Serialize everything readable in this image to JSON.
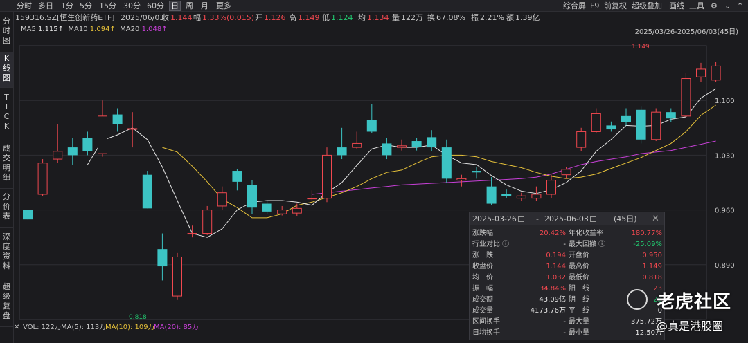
{
  "toolbar": {
    "periods": [
      "分时",
      "多日",
      "1分",
      "5分",
      "15分",
      "30分",
      "60分",
      "日",
      "周",
      "月",
      "更多"
    ],
    "active_period": "日",
    "right": [
      "综合屏",
      "F9",
      "前复权",
      "超级叠加",
      "画线",
      "工具"
    ]
  },
  "info": {
    "code": "159316.SZ[恒生创新药ETF]",
    "date": "2025/06/03",
    "close_label": "收",
    "close": "1.144",
    "change_label": "幅",
    "change": "1.33%(0.015)",
    "open_label": "开",
    "open": "1.126",
    "high_label": "高",
    "high": "1.149",
    "low_label": "低",
    "low": "1.124",
    "avg_label": "均",
    "avg": "1.134",
    "volume_label": "量",
    "volume": "122万",
    "turnover_label": "换",
    "turnover": "67.08%",
    "amplitude_label": "振",
    "amplitude": "2.21%",
    "amount_label": "额",
    "amount": "1.39亿"
  },
  "left_tabs": [
    "分\n时\n图",
    "K\n线\n图",
    "T\nI\nC\nK",
    "成\n交\n明\n细",
    "分\n价\n表",
    "深\n度\n资\n料",
    "超\n级\n复\n盘"
  ],
  "active_tab": "K\n线\n图",
  "ma": {
    "ma5_label": "MA5",
    "ma5": "1.115↑",
    "ma10_label": "MA10",
    "ma10": "1.094↑",
    "ma20_label": "MA20",
    "ma20": "1.048↑"
  },
  "date_range": "2025/03/26-2025/06/03(45日)",
  "y_labels": [
    "1.100",
    "1.030",
    "0.960",
    "0.890"
  ],
  "price_high_label": "1.149",
  "price_low_label": "0.818",
  "volbar": {
    "vol": "VOL: 122万",
    "ma5": "MA(5): 113万",
    "ma10": "MA(10): 109万",
    "ma20": "MA(20): 85万",
    "zero": "0"
  },
  "popup": {
    "start": "2025-03-26",
    "end": "2025-06-03",
    "days": "(45日)",
    "dash": "-",
    "rows": [
      {
        "l1": "涨跌幅",
        "v1": "20.42%",
        "c1": "red",
        "l2": "年化收益率",
        "v2": "180.77%",
        "c2": "red"
      },
      {
        "l1": "行业对比 ⓘ",
        "v1": "-",
        "c1": "white",
        "l2": "最大回撤 ⓘ",
        "v2": "-25.09%",
        "c2": "green"
      },
      {
        "l1": "涨　跌",
        "v1": "0.194",
        "c1": "red",
        "l2": "开盘价",
        "v2": "0.950",
        "c2": "red"
      },
      {
        "l1": "收盘价",
        "v1": "1.144",
        "c1": "red",
        "l2": "最高价",
        "v2": "1.149",
        "c2": "red"
      },
      {
        "l1": "均　价",
        "v1": "1.032",
        "c1": "red",
        "l2": "最低价",
        "v2": "0.818",
        "c2": "red"
      },
      {
        "l1": "振　幅",
        "v1": "34.84%",
        "c1": "red",
        "l2": "阳　线",
        "v2": "23",
        "c2": "red"
      },
      {
        "l1": "成交额",
        "v1": "43.09亿",
        "c1": "white",
        "l2": "阴　线",
        "v2": "22",
        "c2": "green"
      },
      {
        "l1": "成交量",
        "v1": "4173.76万",
        "c1": "white",
        "l2": "平　线",
        "v2": "0",
        "c2": "white"
      },
      {
        "l1": "区间换手",
        "v1": "-",
        "c1": "white",
        "l2": "最大量",
        "v2": "375.72万",
        "c2": "white"
      },
      {
        "l1": "日均换手",
        "v1": "-",
        "c1": "white",
        "l2": "最小量",
        "v2": "12.50万",
        "c2": "white"
      }
    ]
  },
  "watermark": {
    "text1": "老虎社区",
    "text2": "@真是港股圈"
  },
  "colors": {
    "up": "#f0484f",
    "down": "#3cc4c4",
    "ma5": "#e6e6e6",
    "ma10": "#e8c33a",
    "ma20": "#c840d8"
  },
  "chart_data": {
    "type": "candlestick",
    "ylim": [
      0.82,
      1.17
    ],
    "candles": [
      {
        "o": 0.96,
        "c": 0.948,
        "h": 0.96,
        "l": 0.948
      },
      {
        "o": 0.98,
        "c": 1.02,
        "h": 1.025,
        "l": 0.978
      },
      {
        "o": 1.025,
        "c": 1.035,
        "h": 1.07,
        "l": 1.02
      },
      {
        "o": 1.04,
        "c": 1.03,
        "h": 1.052,
        "l": 1.018
      },
      {
        "o": 1.052,
        "c": 1.035,
        "h": 1.06,
        "l": 1.03
      },
      {
        "o": 1.032,
        "c": 1.08,
        "h": 1.1,
        "l": 1.028
      },
      {
        "o": 1.082,
        "c": 1.07,
        "h": 1.09,
        "l": 1.06
      },
      {
        "o": 1.064,
        "c": 1.064,
        "h": 1.085,
        "l": 1.04
      },
      {
        "o": 1.005,
        "c": 0.962,
        "h": 1.01,
        "l": 0.962
      },
      {
        "o": 0.91,
        "c": 0.888,
        "h": 0.93,
        "l": 0.87
      },
      {
        "o": 0.85,
        "c": 0.9,
        "h": 0.905,
        "l": 0.845
      },
      {
        "o": 0.93,
        "c": 0.93,
        "h": 0.94,
        "l": 0.925
      },
      {
        "o": 0.93,
        "c": 0.96,
        "h": 0.965,
        "l": 0.928
      },
      {
        "o": 0.965,
        "c": 0.982,
        "h": 0.99,
        "l": 0.96
      },
      {
        "o": 1.01,
        "c": 0.996,
        "h": 1.012,
        "l": 0.985
      },
      {
        "o": 0.992,
        "c": 0.963,
        "h": 0.998,
        "l": 0.955
      },
      {
        "o": 0.968,
        "c": 0.958,
        "h": 0.972,
        "l": 0.955
      },
      {
        "o": 0.955,
        "c": 0.96,
        "h": 0.965,
        "l": 0.953
      },
      {
        "o": 0.956,
        "c": 0.962,
        "h": 0.968,
        "l": 0.952
      },
      {
        "o": 0.975,
        "c": 0.975,
        "h": 0.985,
        "l": 0.97
      },
      {
        "o": 0.975,
        "c": 1.03,
        "h": 1.04,
        "l": 0.97
      },
      {
        "o": 1.04,
        "c": 1.03,
        "h": 1.065,
        "l": 1.025
      },
      {
        "o": 1.04,
        "c": 1.045,
        "h": 1.06,
        "l": 1.038
      },
      {
        "o": 1.075,
        "c": 1.06,
        "h": 1.095,
        "l": 1.058
      },
      {
        "o": 1.045,
        "c": 1.03,
        "h": 1.052,
        "l": 1.025
      },
      {
        "o": 1.04,
        "c": 1.042,
        "h": 1.05,
        "l": 1.036
      },
      {
        "o": 1.048,
        "c": 1.04,
        "h": 1.052,
        "l": 1.036
      },
      {
        "o": 1.053,
        "c": 1.04,
        "h": 1.062,
        "l": 1.035
      },
      {
        "o": 1.04,
        "c": 1.0,
        "h": 1.05,
        "l": 0.995
      },
      {
        "o": 0.998,
        "c": 1.0,
        "h": 1.005,
        "l": 0.99
      },
      {
        "o": 1.01,
        "c": 1.008,
        "h": 1.015,
        "l": 1.0
      },
      {
        "o": 0.99,
        "c": 0.968,
        "h": 1.002,
        "l": 0.966
      },
      {
        "o": 0.98,
        "c": 0.978,
        "h": 0.986,
        "l": 0.975
      },
      {
        "o": 0.975,
        "c": 0.978,
        "h": 0.982,
        "l": 0.972
      },
      {
        "o": 0.975,
        "c": 0.98,
        "h": 0.99,
        "l": 0.972
      },
      {
        "o": 0.98,
        "c": 0.998,
        "h": 1.005,
        "l": 0.975
      },
      {
        "o": 1.005,
        "c": 1.012,
        "h": 1.015,
        "l": 1.0
      },
      {
        "o": 1.04,
        "c": 1.06,
        "h": 1.065,
        "l": 1.035
      },
      {
        "o": 1.06,
        "c": 1.083,
        "h": 1.09,
        "l": 1.058
      },
      {
        "o": 1.068,
        "c": 1.063,
        "h": 1.073,
        "l": 1.06
      },
      {
        "o": 1.08,
        "c": 1.072,
        "h": 1.09,
        "l": 1.068
      },
      {
        "o": 1.088,
        "c": 1.05,
        "h": 1.092,
        "l": 1.045
      },
      {
        "o": 1.05,
        "c": 1.085,
        "h": 1.09,
        "l": 1.048
      },
      {
        "o": 1.085,
        "c": 1.077,
        "h": 1.09,
        "l": 1.072
      },
      {
        "o": 1.08,
        "c": 1.128,
        "h": 1.135,
        "l": 1.078
      },
      {
        "o": 1.13,
        "c": 1.14,
        "h": 1.148,
        "l": 1.124
      },
      {
        "o": 1.126,
        "c": 1.144,
        "h": 1.149,
        "l": 1.124
      }
    ],
    "ma5": [
      null,
      null,
      null,
      null,
      1.018,
      1.049,
      1.056,
      1.065,
      1.05,
      1.015,
      0.972,
      0.93,
      0.925,
      0.936,
      0.96,
      0.97,
      0.972,
      0.972,
      0.97,
      0.966,
      0.982,
      0.995,
      1.017,
      1.038,
      1.043,
      1.04,
      1.04,
      1.043,
      1.03,
      1.02,
      1.018,
      1.004,
      0.992,
      0.984,
      0.981,
      0.986,
      0.995,
      1.01,
      1.035,
      1.05,
      1.068,
      1.067,
      1.068,
      1.076,
      1.079,
      1.103,
      1.115
    ],
    "ma10": [
      null,
      null,
      null,
      null,
      null,
      null,
      null,
      null,
      null,
      1.04,
      1.034,
      1.016,
      0.996,
      0.974,
      0.963,
      0.95,
      0.95,
      0.955,
      0.966,
      0.97,
      0.976,
      0.982,
      0.99,
      1.0,
      1.008,
      1.011,
      1.02,
      1.028,
      1.03,
      1.03,
      1.028,
      1.022,
      1.018,
      1.014,
      1.008,
      1.003,
      1.0,
      1.002,
      1.006,
      1.013,
      1.02,
      1.027,
      1.036,
      1.045,
      1.06,
      1.081,
      1.094
    ],
    "ma20": [
      null,
      null,
      null,
      null,
      null,
      null,
      null,
      null,
      null,
      null,
      null,
      null,
      null,
      null,
      null,
      null,
      null,
      null,
      null,
      0.98,
      0.982,
      0.984,
      0.986,
      0.988,
      0.99,
      0.992,
      0.993,
      0.994,
      0.995,
      0.996,
      0.997,
      0.998,
      0.999,
      1.0,
      1.002,
      1.006,
      1.012,
      1.018,
      1.022,
      1.025,
      1.028,
      1.032,
      1.034,
      1.036,
      1.04,
      1.044,
      1.048
    ]
  }
}
